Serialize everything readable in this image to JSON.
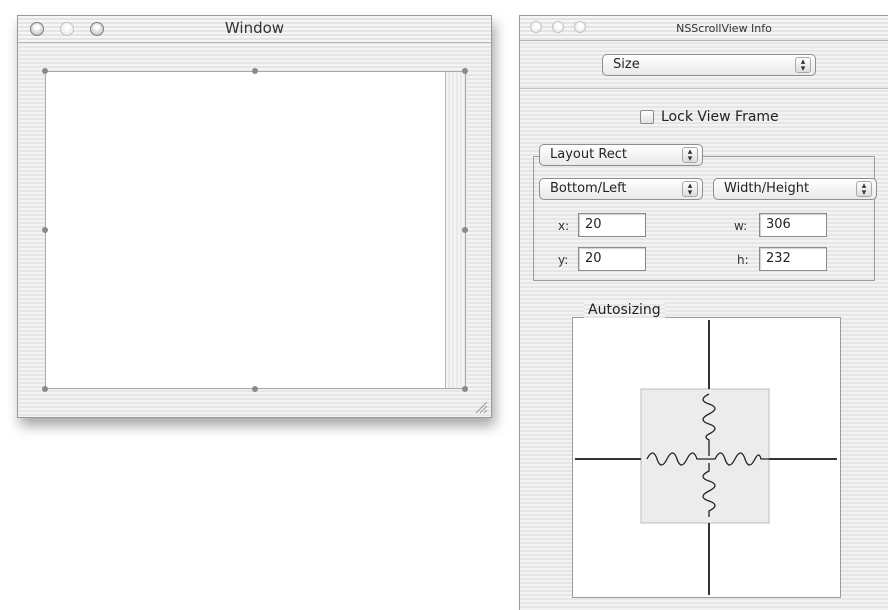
{
  "editor_window": {
    "title": "Window"
  },
  "inspector": {
    "title": "NSScrollView Info",
    "pane_popup": {
      "selected": "Size"
    },
    "lock_view_frame": {
      "label": "Lock View Frame",
      "checked": false
    },
    "layout_popup": {
      "selected": "Layout Rect"
    },
    "origin_popup": {
      "selected": "Bottom/Left"
    },
    "size_popup": {
      "selected": "Width/Height"
    },
    "fields": {
      "x_label": "x:",
      "x_value": "20",
      "y_label": "y:",
      "y_value": "20",
      "w_label": "w:",
      "w_value": "306",
      "h_label": "h:",
      "h_value": "232"
    },
    "autosizing": {
      "label": "Autosizing"
    }
  },
  "icons": {
    "close": "close-icon",
    "minimize": "minimize-icon",
    "zoom": "zoom-icon",
    "popup_arrows": "popup-arrows-icon",
    "spring": "spring-icon",
    "resize_grip": "resize-grip-icon"
  }
}
